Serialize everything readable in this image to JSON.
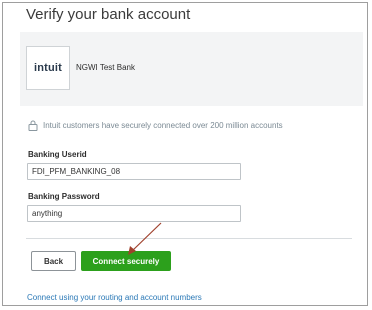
{
  "page": {
    "title": "Verify your bank account"
  },
  "bank": {
    "logo_text": "intuit",
    "name": "NGWI Test Bank"
  },
  "security_note": "Intuit customers have securely connected over 200 million accounts",
  "form": {
    "userid_label": "Banking Userid",
    "userid_value": "FDI_PFM_BANKING_08",
    "password_label": "Banking Password",
    "password_value": "anything"
  },
  "actions": {
    "back_label": "Back",
    "connect_label": "Connect securely"
  },
  "routing_link_text": "Connect using your routing and account numbers",
  "colors": {
    "primary_green": "#2ca01c",
    "link_blue": "#2a78b6",
    "annotation_arrow": "#a0412d"
  },
  "icons": {
    "security": "lock-icon",
    "annotation": "annotation-arrow-icon"
  }
}
